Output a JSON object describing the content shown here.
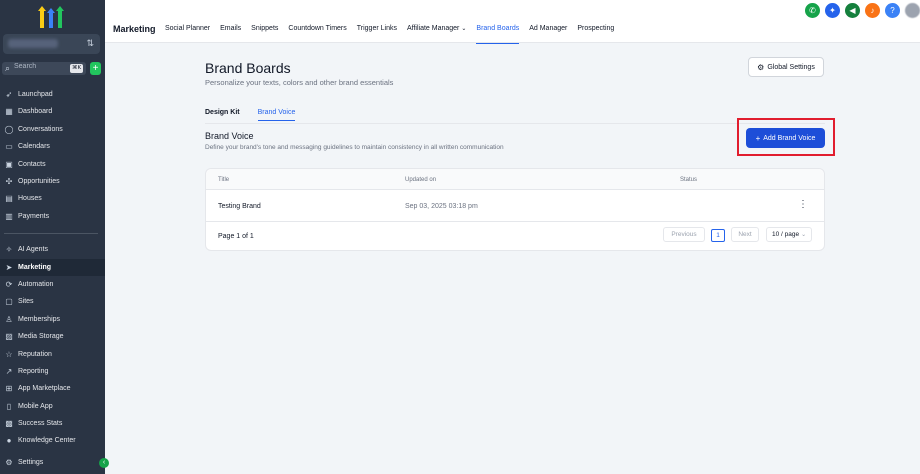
{
  "sidebar": {
    "search_placeholder": "Search",
    "search_shortcut": "⌘K",
    "items": [
      {
        "label": "Launchpad",
        "icon": "rocket-icon"
      },
      {
        "label": "Dashboard",
        "icon": "dashboard-icon"
      },
      {
        "label": "Conversations",
        "icon": "chat-icon"
      },
      {
        "label": "Calendars",
        "icon": "calendar-icon"
      },
      {
        "label": "Contacts",
        "icon": "contacts-icon"
      },
      {
        "label": "Opportunities",
        "icon": "opportunities-icon"
      },
      {
        "label": "Houses",
        "icon": "house-icon"
      },
      {
        "label": "Payments",
        "icon": "payments-icon"
      },
      {
        "label": "AI Agents",
        "icon": "ai-agents-icon"
      },
      {
        "label": "Marketing",
        "icon": "marketing-icon"
      },
      {
        "label": "Automation",
        "icon": "automation-icon"
      },
      {
        "label": "Sites",
        "icon": "sites-icon"
      },
      {
        "label": "Memberships",
        "icon": "memberships-icon"
      },
      {
        "label": "Media Storage",
        "icon": "media-icon"
      },
      {
        "label": "Reputation",
        "icon": "star-icon"
      },
      {
        "label": "Reporting",
        "icon": "reporting-icon"
      },
      {
        "label": "App Marketplace",
        "icon": "marketplace-icon"
      },
      {
        "label": "Mobile App",
        "icon": "mobile-icon"
      },
      {
        "label": "Success Stats",
        "icon": "stats-icon"
      },
      {
        "label": "Knowledge Center",
        "icon": "info-icon"
      },
      {
        "label": "Settings",
        "icon": "gear-icon"
      }
    ]
  },
  "topbar": {
    "section": "Marketing",
    "tabs": [
      "Social Planner",
      "Emails",
      "Snippets",
      "Countdown Timers",
      "Trigger Links",
      "Affiliate Manager",
      "Brand Boards",
      "Ad Manager",
      "Prospecting"
    ],
    "active_tab": "Brand Boards",
    "icon_colors": {
      "phone": "#16a34a",
      "magic": "#2563eb",
      "megaphone": "#15803d",
      "bell": "#f97316",
      "help": "#3b82f6"
    }
  },
  "page": {
    "title": "Brand Boards",
    "subtitle": "Personalize your texts, colors and other brand essentials",
    "global_settings": "Global Settings",
    "subtabs": [
      "Design Kit",
      "Brand Voice"
    ],
    "section_title": "Brand Voice",
    "section_desc": "Define your brand's tone and messaging guidelines to maintain consistency in all written communication",
    "add_button": "Add Brand Voice"
  },
  "table": {
    "columns": [
      "Title",
      "Updated on",
      "Status"
    ],
    "rows": [
      {
        "title": "Testing Brand",
        "updated": "Sep 03, 2025 03:18 pm",
        "status": ""
      }
    ],
    "pager": {
      "label": "Page 1 of 1",
      "previous": "Previous",
      "current": "1",
      "next": "Next",
      "page_size": "10 / page"
    }
  },
  "colors": {
    "accent": "#2563eb",
    "highlight": "#e11d2e",
    "sidebar_bg": "#2a3444"
  }
}
